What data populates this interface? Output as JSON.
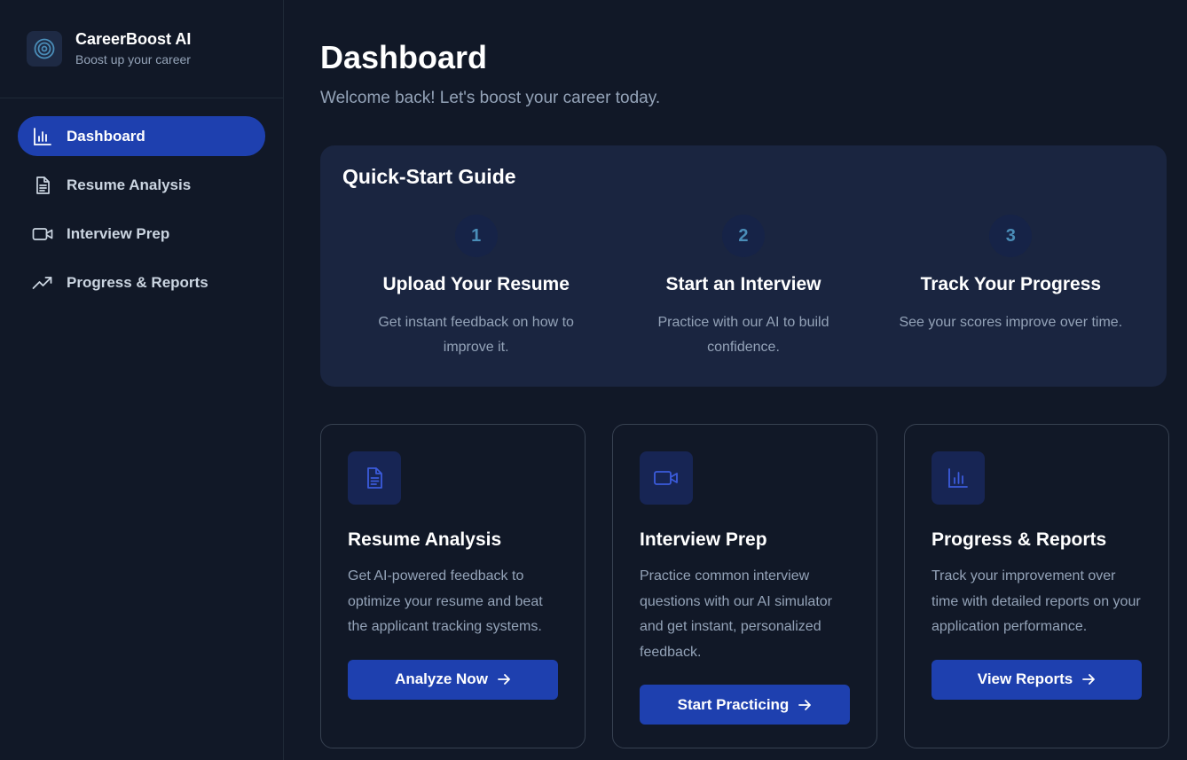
{
  "brand": {
    "name": "CareerBoost AI",
    "tagline": "Boost up your career",
    "logo_icon": "target-icon"
  },
  "sidebar": {
    "items": [
      {
        "label": "Dashboard",
        "icon": "bar-chart-icon",
        "active": true
      },
      {
        "label": "Resume Analysis",
        "icon": "document-icon",
        "active": false
      },
      {
        "label": "Interview Prep",
        "icon": "video-camera-icon",
        "active": false
      },
      {
        "label": "Progress & Reports",
        "icon": "trending-up-icon",
        "active": false
      }
    ]
  },
  "header": {
    "title": "Dashboard",
    "subtitle": "Welcome back! Let's boost your career today."
  },
  "guide": {
    "title": "Quick-Start Guide",
    "steps": [
      {
        "number": "1",
        "title": "Upload Your Resume",
        "description": "Get instant feedback on how to improve it."
      },
      {
        "number": "2",
        "title": "Start an Interview",
        "description": "Practice with our AI to build confidence."
      },
      {
        "number": "3",
        "title": "Track Your Progress",
        "description": "See your scores improve over time."
      }
    ]
  },
  "cards": [
    {
      "icon": "document-icon",
      "title": "Resume Analysis",
      "description": "Get AI-powered feedback to optimize your resume and beat the applicant tracking systems.",
      "button": "Analyze Now"
    },
    {
      "icon": "video-camera-icon",
      "title": "Interview Prep",
      "description": "Practice common interview questions with our AI simulator and get instant, personalized feedback.",
      "button": "Start Practicing"
    },
    {
      "icon": "bar-chart-icon",
      "title": "Progress & Reports",
      "description": "Track your improvement over time with detailed reports on your application performance.",
      "button": "View Reports"
    }
  ],
  "colors": {
    "background": "#111827",
    "accent": "#1e40af",
    "panel": "#1a2540",
    "muted_text": "#94a3b8"
  }
}
